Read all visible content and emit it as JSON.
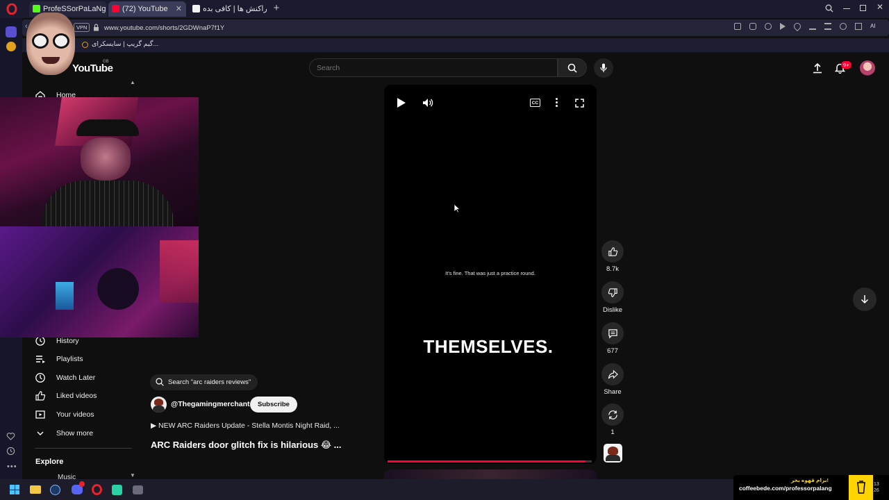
{
  "browser": {
    "tabs": [
      {
        "label": "ProfeSSorPaLaNg Stream",
        "active": false
      },
      {
        "label": "(72) YouTube",
        "active": true
      },
      {
        "label": "تراکنش ها | کافی بده",
        "active": false
      }
    ],
    "new_tab": "+",
    "vpn_badge": "VPN",
    "url": "www.youtube.com/shorts/2GDWnaP7f1Y",
    "bookmark": "گیم گریپ | سایسکرای..."
  },
  "youtube": {
    "logo_text": "YouTube",
    "logo_region": "GB",
    "search_placeholder": "Search",
    "notification_badge": "9+",
    "nav": {
      "home": "Home",
      "history": "History",
      "playlists": "Playlists",
      "watch_later": "Watch Later",
      "liked_videos": "Liked videos",
      "your_videos": "Your videos",
      "show_more": "Show more",
      "explore": "Explore",
      "music": "Music"
    },
    "short": {
      "subtitle": "It's fine. That was just a practice round.",
      "caption": "THEMSELVES.",
      "progress": 0.97
    },
    "actions": {
      "likes": "8.7k",
      "dislike": "Dislike",
      "comments": "677",
      "share": "Share",
      "remix": "1"
    },
    "info": {
      "search_chip": "Search \"arc raiders reviews\"",
      "channel": "@Thegamingmerchant",
      "subscribe": "Subscribe",
      "related_video": "▶  NEW ARC Raiders Update - Stella Montis Night Raid, ...",
      "title": "ARC Raiders door glitch fix is hilarious 😂 ..."
    }
  },
  "overlay": {
    "coffee_title": "برام قهوه بخر!",
    "coffee_url": "coffeebede.com/professorpalang",
    "clock_line1": "13",
    "clock_line2": "26"
  },
  "colors": {
    "accent_red": "#ff0033",
    "opera_red": "#e8232c",
    "coffee_yellow": "#ffd400"
  }
}
